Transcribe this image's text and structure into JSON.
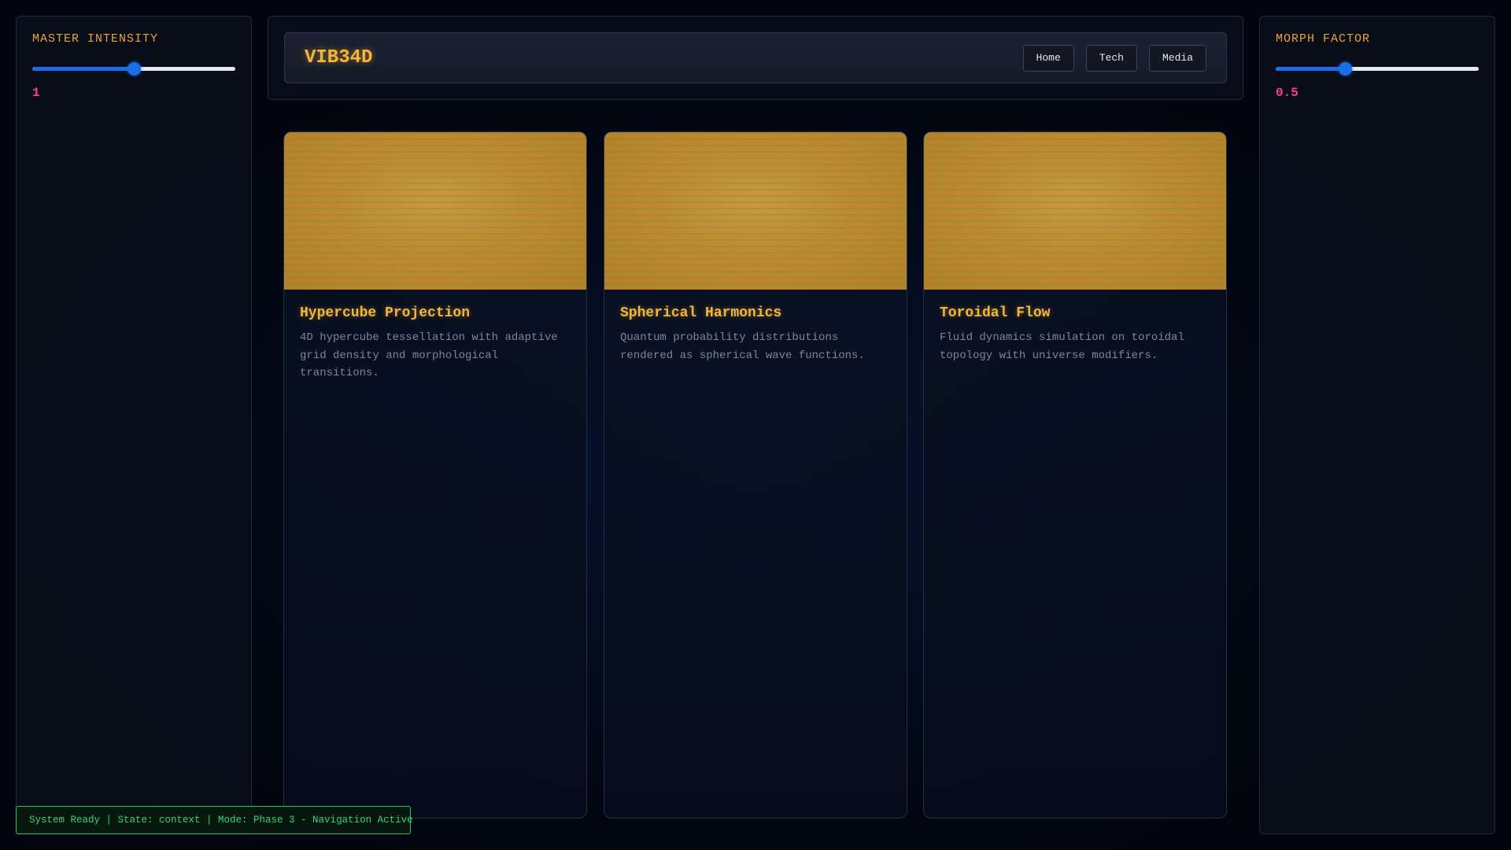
{
  "left_panel": {
    "label": "MASTER INTENSITY",
    "value_text": "1",
    "slider_fraction": 0.5
  },
  "right_panel": {
    "label": "MORPH FACTOR",
    "value_text": "0.5",
    "slider_fraction": 0.34
  },
  "header": {
    "brand": "VIB34D",
    "nav": [
      "Home",
      "Tech",
      "Media"
    ]
  },
  "cards": [
    {
      "title": "Hypercube Projection",
      "description": "4D hypercube tessellation with adaptive grid density and morphological transitions."
    },
    {
      "title": "Spherical Harmonics",
      "description": "Quantum probability distributions rendered as spherical wave functions."
    },
    {
      "title": "Toroidal Flow",
      "description": "Fluid dynamics simulation on toroidal topology with universe modifiers."
    }
  ],
  "status": {
    "text": "System Ready | State: context | Mode: Phase 3 - Navigation Active"
  },
  "colors": {
    "accent_amber": "#f3b53a",
    "slider_blue": "#1a6fe8",
    "value_pink": "#ff3f8e",
    "status_green": "#22c55e"
  }
}
